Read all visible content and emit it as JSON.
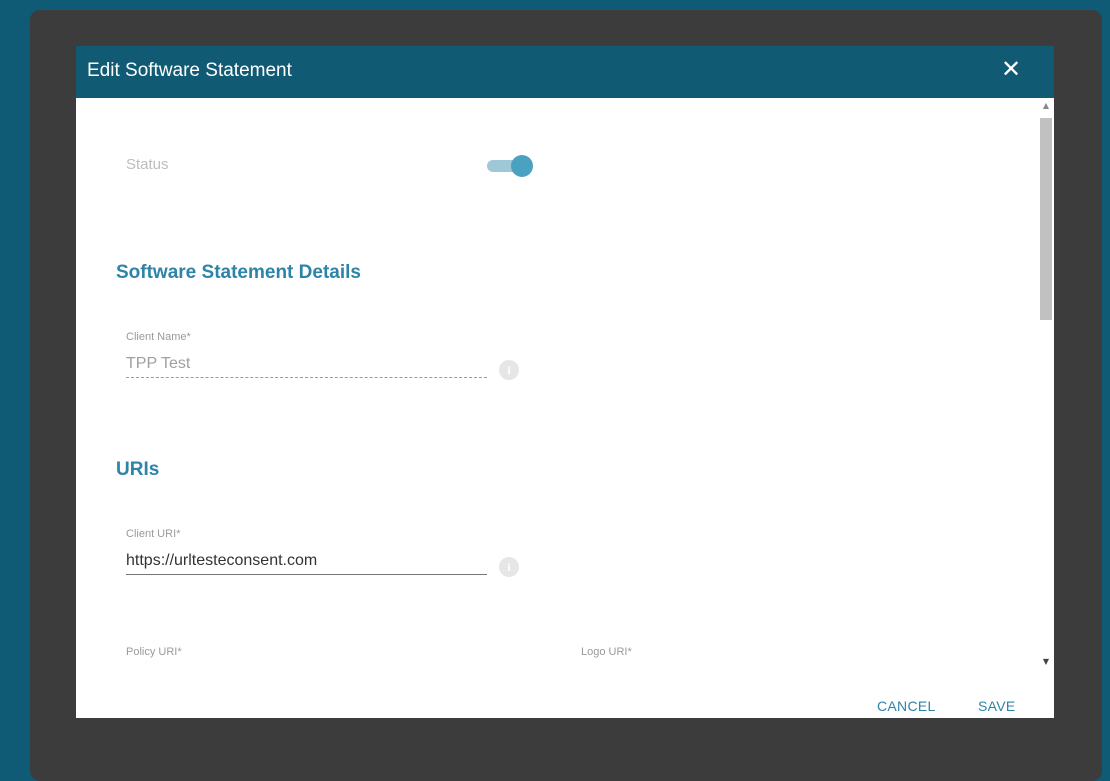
{
  "dialog": {
    "title": "Edit Software Statement",
    "close_icon": "close-icon"
  },
  "status": {
    "label": "Status",
    "enabled": true
  },
  "details_section": {
    "title": "Software Statement Details",
    "client_name": {
      "label": "Client Name*",
      "value": "TPP Test",
      "disabled": true
    }
  },
  "uris_section": {
    "title": "URIs",
    "client_uri": {
      "label": "Client URI*",
      "value": "https://urlteste​consent.com"
    },
    "policy_uri": {
      "label": "Policy URI*"
    },
    "logo_uri": {
      "label": "Logo URI*"
    }
  },
  "footer": {
    "cancel_label": "CANCEL",
    "save_label": "SAVE"
  },
  "colors": {
    "header": "#105a74",
    "accent": "#2d84a8",
    "backdrop": "#3c3c3c",
    "page_bg": "#0f5a74"
  }
}
